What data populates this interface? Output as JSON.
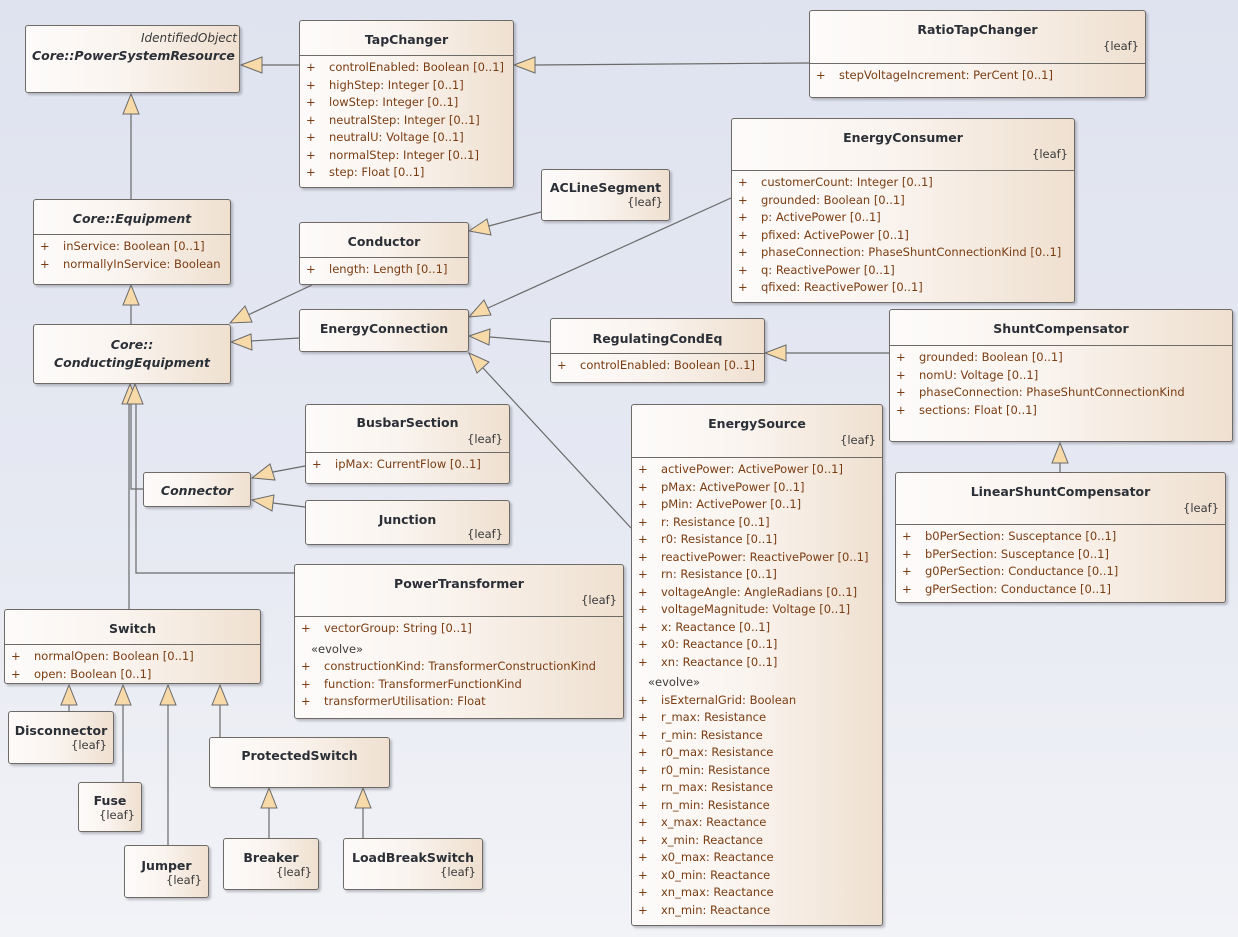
{
  "diagram": {
    "classes": {
      "psr": {
        "stereotype": "IdentifiedObject",
        "name": "Core::PowerSystemResource"
      },
      "tapchanger": {
        "name": "TapChanger",
        "attrs": [
          "controlEnabled: Boolean [0..1]",
          "highStep: Integer [0..1]",
          "lowStep: Integer [0..1]",
          "neutralStep: Integer [0..1]",
          "neutralU: Voltage [0..1]",
          "normalStep: Integer [0..1]",
          "step: Float [0..1]"
        ]
      },
      "ratiotap": {
        "name": "RatioTapChanger",
        "leaf": "{leaf}",
        "attrs": [
          "stepVoltageIncrement: PerCent [0..1]"
        ]
      },
      "equipment": {
        "name": "Core::Equipment",
        "attrs": [
          "inService: Boolean [0..1]",
          "normallyInService: Boolean"
        ]
      },
      "conductor": {
        "name": "Conductor",
        "attrs": [
          "length: Length [0..1]"
        ]
      },
      "acline": {
        "name": "ACLineSegment",
        "leaf": "{leaf}"
      },
      "consumer": {
        "name": "EnergyConsumer",
        "leaf": "{leaf}",
        "attrs": [
          "customerCount: Integer [0..1]",
          "grounded: Boolean [0..1]",
          "p: ActivePower [0..1]",
          "pfixed: ActivePower [0..1]",
          "phaseConnection: PhaseShuntConnectionKind [0..1]",
          "q: ReactivePower [0..1]",
          "qfixed: ReactivePower [0..1]"
        ]
      },
      "condeq": {
        "name1": "Core::",
        "name2": "ConductingEquipment"
      },
      "econn": {
        "name": "EnergyConnection"
      },
      "regcond": {
        "name": "RegulatingCondEq",
        "attrs": [
          "controlEnabled: Boolean [0..1]"
        ]
      },
      "shunt": {
        "name": "ShuntCompensator",
        "attrs": [
          "grounded: Boolean [0..1]",
          "nomU: Voltage [0..1]",
          "phaseConnection: PhaseShuntConnectionKind",
          "sections: Float [0..1]"
        ]
      },
      "busbar": {
        "name": "BusbarSection",
        "leaf": "{leaf}",
        "attrs": [
          "ipMax: CurrentFlow [0..1]"
        ]
      },
      "connector": {
        "name": "Connector"
      },
      "junction": {
        "name": "Junction",
        "leaf": "{leaf}"
      },
      "source": {
        "name": "EnergySource",
        "leaf": "{leaf}",
        "attrs": [
          "activePower: ActivePower [0..1]",
          "pMax: ActivePower [0..1]",
          "pMin: ActivePower [0..1]",
          "r: Resistance [0..1]",
          "r0: Resistance [0..1]",
          "reactivePower: ReactivePower [0..1]",
          "rn: Resistance [0..1]",
          "voltageAngle: AngleRadians [0..1]",
          "voltageMagnitude: Voltage [0..1]",
          "x: Reactance [0..1]",
          "x0: Reactance [0..1]",
          "xn: Reactance [0..1]"
        ],
        "section": "«evolve»",
        "evolve_attrs": [
          "isExternalGrid: Boolean",
          "r_max: Resistance",
          "r_min: Resistance",
          "r0_max: Resistance",
          "r0_min: Resistance",
          "rn_max: Resistance",
          "rn_min: Resistance",
          "x_max: Reactance",
          "x_min: Reactance",
          "x0_max: Reactance",
          "x0_min: Reactance",
          "xn_max: Reactance",
          "xn_min: Reactance"
        ]
      },
      "linshunt": {
        "name": "LinearShuntCompensator",
        "leaf": "{leaf}",
        "attrs": [
          "b0PerSection: Susceptance [0..1]",
          "bPerSection: Susceptance [0..1]",
          "g0PerSection: Conductance [0..1]",
          "gPerSection: Conductance [0..1]"
        ]
      },
      "transformer": {
        "name": "PowerTransformer",
        "leaf": "{leaf}",
        "attrs": [
          "vectorGroup: String [0..1]"
        ],
        "section": "«evolve»",
        "evolve_attrs": [
          "constructionKind: TransformerConstructionKind",
          "function: TransformerFunctionKind",
          "transformerUtilisation: Float"
        ]
      },
      "switch": {
        "name": "Switch",
        "attrs": [
          "normalOpen: Boolean [0..1]",
          "open: Boolean [0..1]"
        ]
      },
      "disconnector": {
        "name": "Disconnector",
        "leaf": "{leaf}"
      },
      "fuse": {
        "name": "Fuse",
        "leaf": "{leaf}"
      },
      "jumper": {
        "name": "Jumper",
        "leaf": "{leaf}"
      },
      "protected": {
        "name": "ProtectedSwitch"
      },
      "breaker": {
        "name": "Breaker",
        "leaf": "{leaf}"
      },
      "loadbreak": {
        "name": "LoadBreakSwitch",
        "leaf": "{leaf}"
      }
    },
    "plus_symbol": "+"
  }
}
